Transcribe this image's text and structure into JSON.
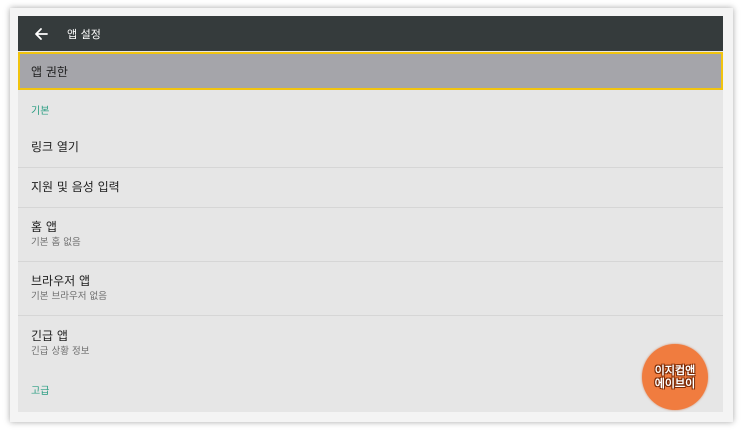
{
  "appbar": {
    "title": "앱 설정",
    "back_icon": "arrow-left-icon"
  },
  "highlight_item": {
    "label": "앱 권한"
  },
  "sections": {
    "basic_header": "기본",
    "advanced_header": "고급"
  },
  "items": [
    {
      "title": "링크 열기",
      "subtitle": ""
    },
    {
      "title": "지원 및 음성 입력",
      "subtitle": ""
    },
    {
      "title": "홈 앱",
      "subtitle": "기본 홈 없음"
    },
    {
      "title": "브라우저 앱",
      "subtitle": "기본 브라우저 없음"
    },
    {
      "title": "긴급 앱",
      "subtitle": "긴급 상황 정보"
    }
  ],
  "watermark": {
    "line1": "이지컴앤",
    "line2": "에이브이"
  },
  "colors": {
    "appbar": "#353b3c",
    "section_header": "#2a9d82",
    "highlight_bg": "#a5a5aa",
    "highlight_border": "#f1c40f",
    "badge": "#f07c3f"
  }
}
